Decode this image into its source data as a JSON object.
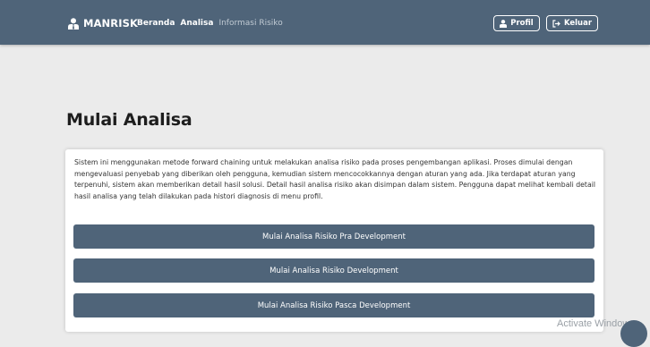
{
  "navbar": {
    "brand_icon": "user-tie-icon",
    "brand": "MANRISK",
    "links": [
      {
        "label": "Beranda",
        "active": true
      },
      {
        "label": "Analisa",
        "active": true
      },
      {
        "label": "Informasi Risiko",
        "active": false
      }
    ],
    "profile_button": {
      "icon": "user-icon",
      "label": "Profil"
    },
    "logout_button": {
      "icon": "sign-out-icon",
      "label": "Keluar"
    }
  },
  "main": {
    "title": "Mulai Analisa",
    "description": "Sistem ini menggunakan metode forward chaining untuk melakukan analisa risiko pada proses pengembangan aplikasi. Proses dimulai dengan mengevaluasi penyebab yang diberikan oleh pengguna, kemudian sistem mencocokkannya dengan aturan yang ada. Jika terdapat aturan yang terpenuhi, sistem akan memberikan detail hasil solusi. Detail hasil analisa risiko akan disimpan dalam sistem. Pengguna dapat melihat kembali detail hasil analisa yang telah dilakukan pada histori diagnosis di menu profil.",
    "buttons": [
      "Mulai Analisa Risiko Pra Development",
      "Mulai Analisa Risiko Development",
      "Mulai Analisa Risiko Pasca Development"
    ]
  },
  "watermark": "Activate Windows",
  "colors": {
    "navbar": "#4f6479",
    "button": "#4f6479",
    "background": "#ebebeb",
    "card": "#ffffff"
  }
}
